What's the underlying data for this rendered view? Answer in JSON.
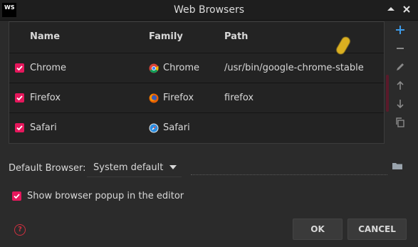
{
  "window": {
    "logo": "WS",
    "title": "Web Browsers"
  },
  "table": {
    "columns": [
      "Name",
      "Family",
      "Path"
    ],
    "rows": [
      {
        "checked": true,
        "name": "Chrome",
        "family": "Chrome",
        "family_icon": "chrome-icon",
        "path": "/usr/bin/google-chrome-stable"
      },
      {
        "checked": true,
        "name": "Firefox",
        "family": "Firefox",
        "family_icon": "firefox-icon",
        "path": "firefox"
      },
      {
        "checked": true,
        "name": "Safari",
        "family": "Safari",
        "family_icon": "safari-icon",
        "path": ""
      }
    ]
  },
  "toolbar": {
    "icons": [
      "add-icon",
      "remove-icon",
      "edit-icon",
      "move-up-icon",
      "move-down-icon",
      "copy-icon"
    ]
  },
  "default_browser": {
    "label": "Default Browser:",
    "selected": "System default",
    "path_value": ""
  },
  "popup_option": {
    "checked": true,
    "label": "Show browser popup in the editor"
  },
  "buttons": {
    "help": "?",
    "ok": "OK",
    "cancel": "CANCEL"
  },
  "colors": {
    "accent": "#e6175c",
    "background": "#2b2b2b",
    "panel": "#232323"
  }
}
